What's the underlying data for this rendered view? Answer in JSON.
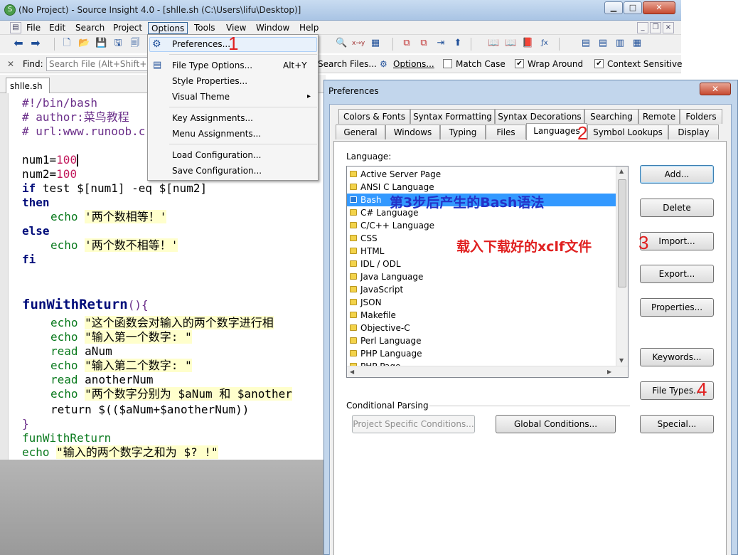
{
  "window": {
    "title": "(No Project) - Source Insight 4.0 - [shlle.sh (C:\\Users\\lifu\\Desktop)]",
    "app_icon": "source-insight-icon"
  },
  "menubar": {
    "items": [
      "File",
      "Edit",
      "Search",
      "Project",
      "Options",
      "Tools",
      "View",
      "Window",
      "Help"
    ],
    "active": "Options"
  },
  "findbar": {
    "label": "Find:",
    "placeholder": "Search File (Alt+Shift+F)",
    "search_files": "Search Files...",
    "options": "Options...",
    "match_case": "Match Case",
    "match_case_checked": false,
    "wrap_around": "Wrap Around",
    "wrap_around_checked": true,
    "context_sensitive": "Context Sensitive",
    "context_sensitive_checked": true
  },
  "file_tab": {
    "name": "shlle.sh",
    "close": "×"
  },
  "editor": {
    "shebang": "#!/bin/bash",
    "author": "# author:菜鸟教程",
    "url": "# url:www.runoob.c",
    "num1_var": "num1=",
    "num1_val": "100",
    "num2_var": "num2=",
    "num2_val": "100",
    "if_kw": "if",
    "if_rest": " test $[num1] -eq $[num2]",
    "then_kw": "then",
    "echo_kw": "echo",
    "str_equal": "'两个数相等！'",
    "else_kw": "else",
    "str_notequal": "'两个数不相等！'",
    "fi_kw": "fi",
    "func_name": "funWithReturn",
    "func_paren": "(){",
    "str_desc": "\"这个函数会对输入的两个数字进行相",
    "str_first": "\"输入第一个数字: \"",
    "read_kw": "read",
    "var_a": "aNum",
    "str_second": "\"输入第二个数字: \"",
    "var_b": "anotherNum",
    "str_result": "\"两个数字分别为 $aNum 和 $another",
    "return_line": "return $(($aNum+$anotherNum))",
    "close_brace": "}",
    "call_func": "funWithReturn",
    "str_sum": "\"输入的两个数字之和为 $? !\""
  },
  "options_menu": {
    "items": [
      {
        "label": "Preferences...",
        "shortcut": ""
      },
      {
        "label": "File Type Options...",
        "shortcut": "Alt+Y"
      },
      {
        "label": "Style Properties...",
        "shortcut": ""
      },
      {
        "label": "Visual Theme",
        "shortcut": "▸"
      },
      {
        "label": "Key Assignments...",
        "shortcut": ""
      },
      {
        "label": "Menu Assignments...",
        "shortcut": ""
      },
      {
        "label": "Load Configuration...",
        "shortcut": ""
      },
      {
        "label": "Save Configuration...",
        "shortcut": ""
      }
    ]
  },
  "dialog": {
    "title": "Preferences",
    "tabs_row1": [
      "Colors & Fonts",
      "Syntax Formatting",
      "Syntax Decorations",
      "Searching",
      "Remote",
      "Folders"
    ],
    "tabs_row2": [
      "General",
      "Windows",
      "Typing",
      "Files",
      "Languages",
      "Symbol Lookups",
      "Display"
    ],
    "active_tab": "Languages",
    "language_label": "Language:",
    "languages": [
      "Active Server Page",
      "ANSI C Language",
      "Bash",
      "C# Language",
      "C/C++ Language",
      "CSS",
      "HTML",
      "IDL / ODL",
      "Java Language",
      "JavaScript",
      "JSON",
      "Makefile",
      "Objective-C",
      "Perl Language",
      "PHP Language",
      "PHP Page"
    ],
    "selected_language": "Bash",
    "buttons": {
      "add": "Add...",
      "delete": "Delete",
      "import": "Import...",
      "export": "Export...",
      "properties": "Properties...",
      "keywords": "Keywords...",
      "file_types": "File Types...",
      "special": "Special..."
    },
    "conditional_label": "Conditional Parsing",
    "project_conditions": "Project Specific Conditions...",
    "global_conditions": "Global Conditions..."
  },
  "annotations": {
    "n1": "1",
    "n2": "2",
    "n3": "3",
    "n4": "4",
    "bash_note": "第3步后产生的Bash语法",
    "import_note": "载入下载好的xclf文件"
  }
}
